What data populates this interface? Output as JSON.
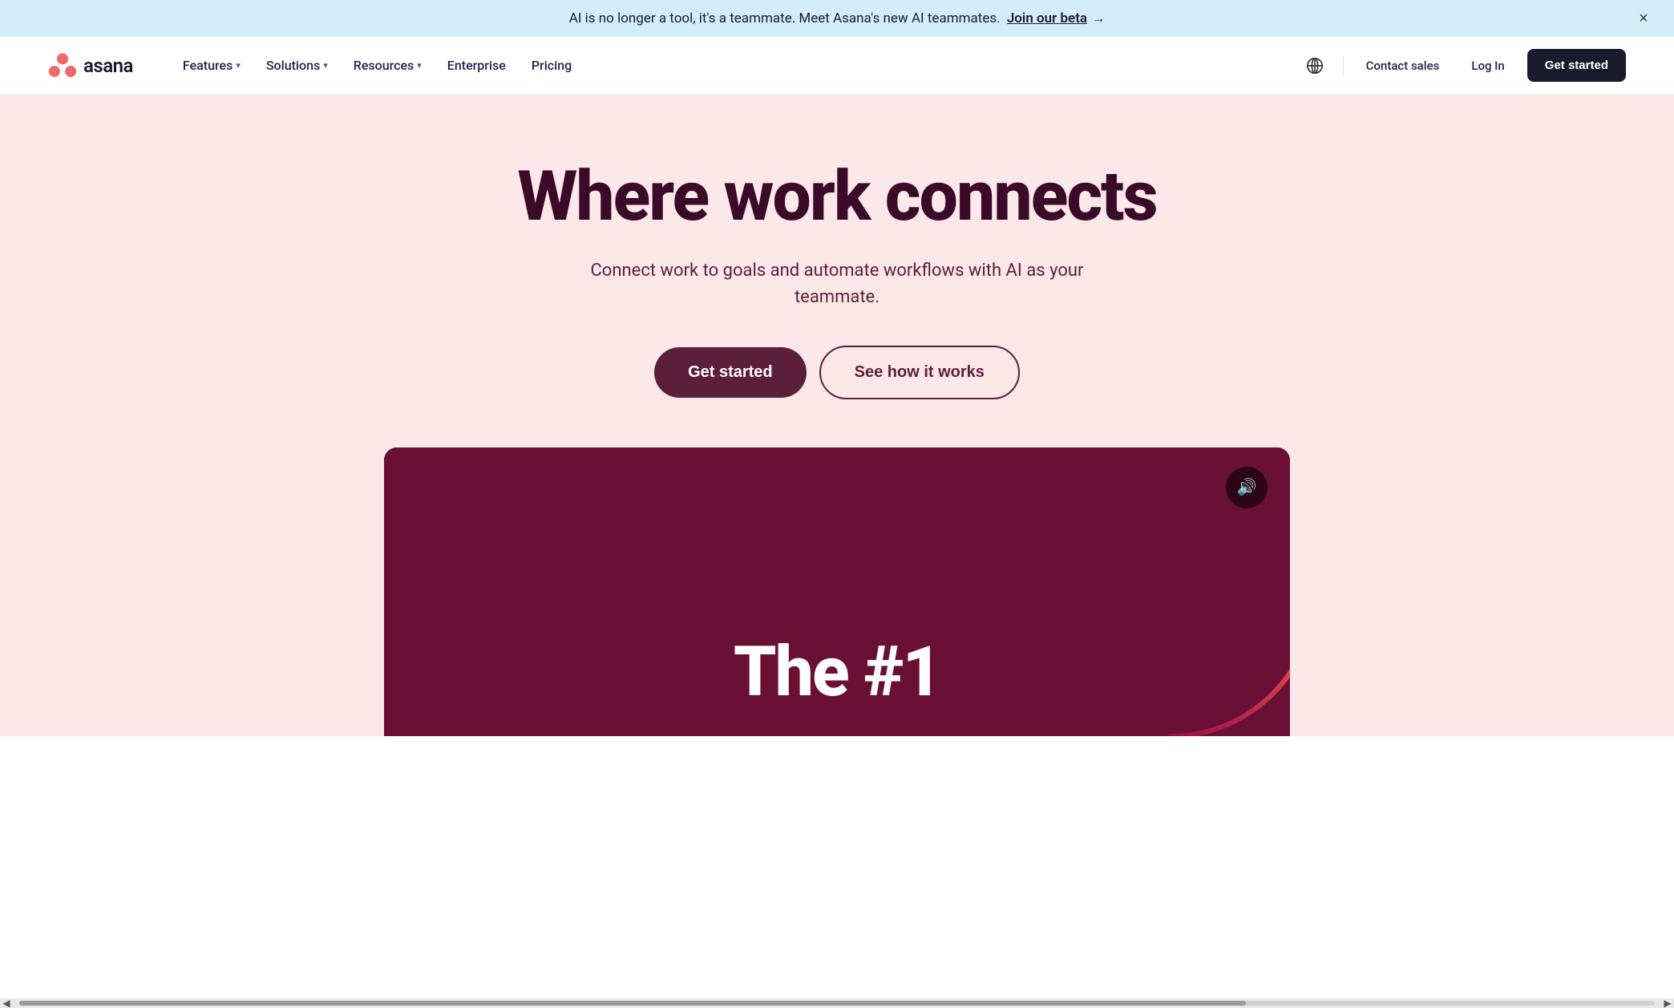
{
  "banner": {
    "text": "AI is no longer a tool, it's a teammate. Meet Asana's new AI teammates.",
    "link_text": "Join our beta",
    "link_arrow": "→",
    "close_label": "×"
  },
  "navbar": {
    "logo_text": "asana",
    "nav_items": [
      {
        "label": "Features",
        "has_dropdown": true
      },
      {
        "label": "Solutions",
        "has_dropdown": true
      },
      {
        "label": "Resources",
        "has_dropdown": true
      },
      {
        "label": "Enterprise",
        "has_dropdown": false
      },
      {
        "label": "Pricing",
        "has_dropdown": false
      }
    ],
    "contact_sales": "Contact sales",
    "log_in": "Log In",
    "get_started": "Get started",
    "globe_label": "language selector"
  },
  "hero": {
    "title": "Where work connects",
    "subtitle": "Connect work to goals and automate workflows with AI as your teammate.",
    "btn_primary": "Get started",
    "btn_secondary": "See how it works"
  },
  "video": {
    "text": "The    #1",
    "sound_icon": "🔊"
  },
  "colors": {
    "banner_bg": "#d4eef9",
    "hero_bg": "#fce8e8",
    "video_bg": "#6b1035",
    "primary_btn_bg": "#5c1f3a",
    "title_color": "#3b0a28",
    "subtitle_color": "#5c1f3a"
  }
}
